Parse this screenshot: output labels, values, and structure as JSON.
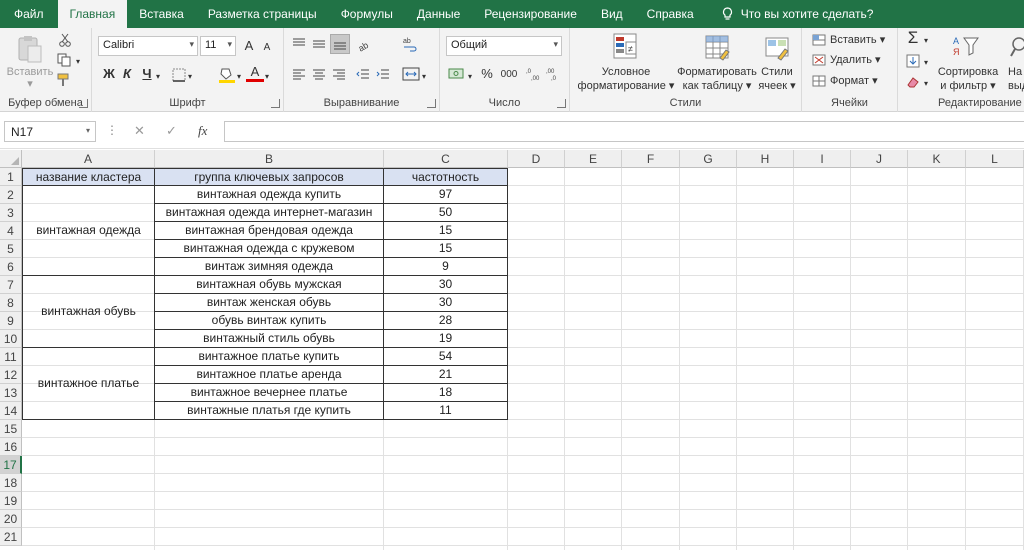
{
  "tabs": [
    {
      "label": "Файл",
      "active": false
    },
    {
      "label": "Главная",
      "active": true
    },
    {
      "label": "Вставка",
      "active": false
    },
    {
      "label": "Разметка страницы",
      "active": false
    },
    {
      "label": "Формулы",
      "active": false
    },
    {
      "label": "Данные",
      "active": false
    },
    {
      "label": "Рецензирование",
      "active": false
    },
    {
      "label": "Вид",
      "active": false
    },
    {
      "label": "Справка",
      "active": false
    }
  ],
  "tell_me": "Что вы хотите сделать?",
  "ribbon": {
    "clipboard": {
      "label": "Буфер обмена",
      "paste": "Вставить"
    },
    "font": {
      "label": "Шрифт",
      "font_name": "Calibri",
      "font_size": "11",
      "bold": "Ж",
      "italic": "К",
      "underline": "Ч",
      "grow": "A",
      "shrink": "A",
      "font_color_letter": "A"
    },
    "alignment": {
      "label": "Выравнивание"
    },
    "number": {
      "label": "Число",
      "format": "Общий",
      "percent": "%",
      "thousands": "000"
    },
    "styles": {
      "label": "Стили",
      "conditional_1": "Условное",
      "conditional_2": "форматирование",
      "as_table_1": "Форматировать",
      "as_table_2": "как таблицу",
      "cell_styles_1": "Стили",
      "cell_styles_2": "ячеек"
    },
    "cells": {
      "label": "Ячейки",
      "insert": "Вставить",
      "delete": "Удалить",
      "format": "Формат"
    },
    "editing": {
      "label": "Редактирование",
      "sort_1": "Сортировка",
      "sort_2": "и фильтр",
      "find_1": "На",
      "find_2": "выде"
    }
  },
  "formula_bar": {
    "name_box": "N17",
    "fx": "fx",
    "cancel": "✕",
    "enter": "✓",
    "formula": ""
  },
  "accent_color": "#217346",
  "header_fill_color": "#d9e1f2",
  "columns": [
    "A",
    "B",
    "C",
    "D",
    "E",
    "F",
    "G",
    "H",
    "I",
    "J",
    "K",
    "L"
  ],
  "rows": [
    "1",
    "2",
    "3",
    "4",
    "5",
    "6",
    "7",
    "8",
    "9",
    "10",
    "11",
    "12",
    "13",
    "14",
    "15",
    "16",
    "17",
    "18",
    "19",
    "20",
    "21"
  ],
  "selected_row": "17",
  "table": {
    "headers": [
      "название кластера",
      "группа ключевых запросов",
      "частотность"
    ],
    "clusters": [
      {
        "name": "винтажная одежда",
        "rows": [
          {
            "query": "винтажная одежда купить",
            "freq": "97"
          },
          {
            "query": "винтажная одежда интернет-магазин",
            "freq": "50"
          },
          {
            "query": "винтажная брендовая одежда",
            "freq": "15"
          },
          {
            "query": "винтажная одежда с кружевом",
            "freq": "15"
          },
          {
            "query": "винтаж зимняя одежда",
            "freq": "9"
          }
        ]
      },
      {
        "name": "винтажная обувь",
        "rows": [
          {
            "query": "винтажная обувь мужская",
            "freq": "30"
          },
          {
            "query": "винтаж женская обувь",
            "freq": "30"
          },
          {
            "query": "обувь винтаж купить",
            "freq": "28"
          },
          {
            "query": "винтажный стиль обувь",
            "freq": "19"
          }
        ]
      },
      {
        "name": "винтажное платье",
        "rows": [
          {
            "query": "винтажное платье купить",
            "freq": "54"
          },
          {
            "query": "винтажное платье аренда",
            "freq": "21"
          },
          {
            "query": "винтажное вечернее платье",
            "freq": "18"
          },
          {
            "query": "винтажные платья где купить",
            "freq": "11"
          }
        ]
      }
    ]
  }
}
